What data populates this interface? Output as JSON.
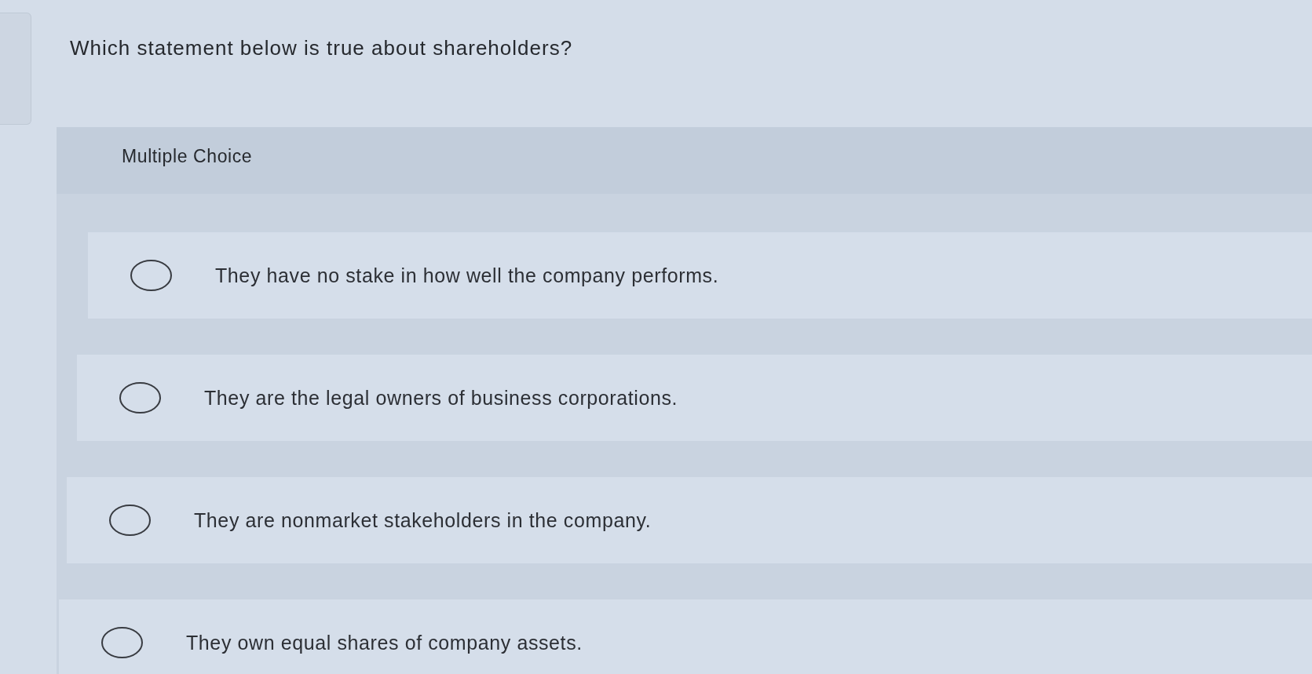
{
  "question": {
    "text": "Which statement below is true about shareholders?"
  },
  "answer_panel": {
    "heading": "Multiple Choice",
    "options": [
      {
        "label": "They have no stake in how well the company performs.",
        "selected": false
      },
      {
        "label": "They are the legal owners of business corporations.",
        "selected": false
      },
      {
        "label": "They are nonmarket stakeholders in the company.",
        "selected": false
      },
      {
        "label": "They own equal shares of company assets.",
        "selected": false
      }
    ]
  }
}
